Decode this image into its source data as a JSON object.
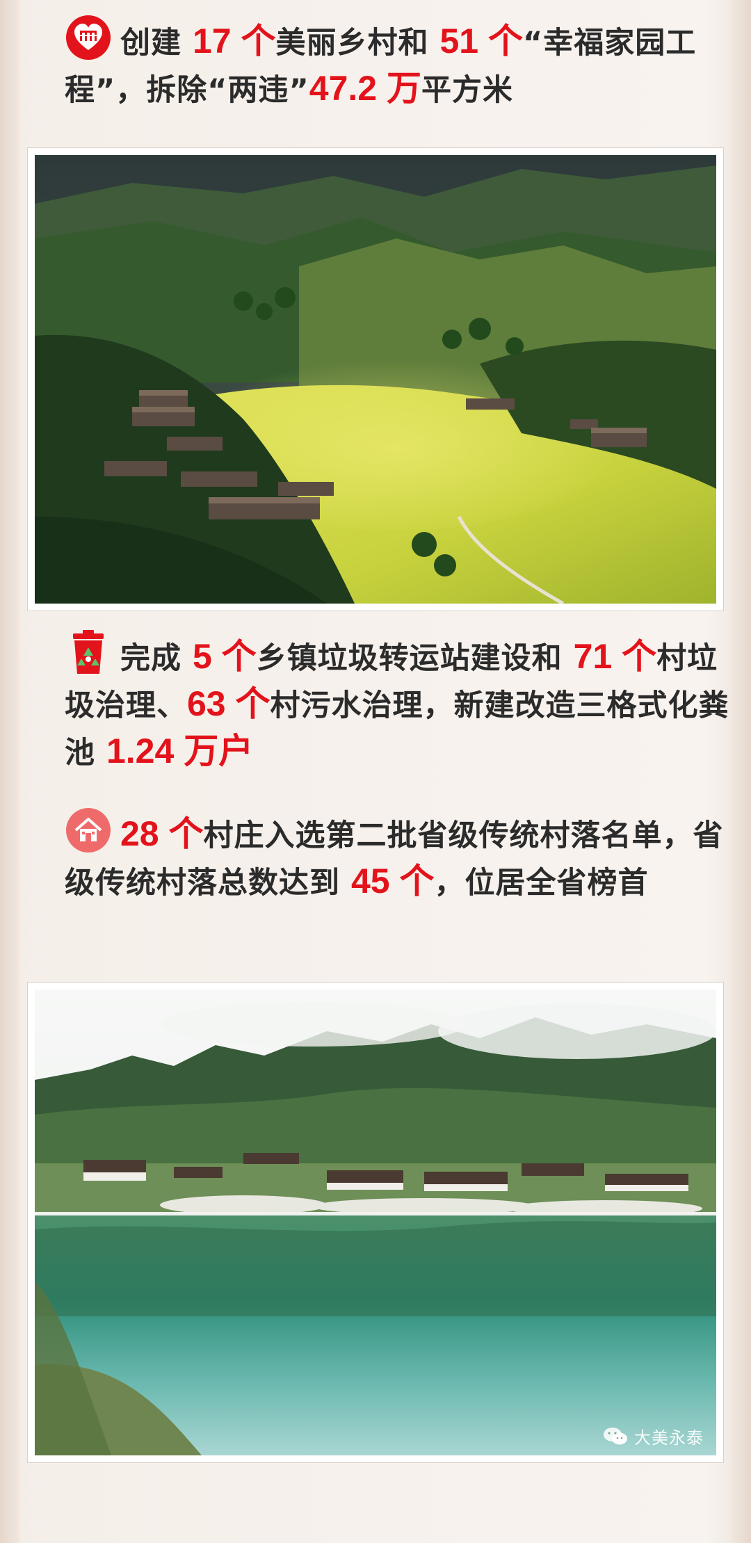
{
  "sections": [
    {
      "icon": "village-badge-icon",
      "parts": [
        {
          "t": "创建 ",
          "h": false
        },
        {
          "t": "17 个",
          "h": true
        },
        {
          "t": "美丽乡村和 ",
          "h": false
        },
        {
          "t": "51 个",
          "h": true
        },
        {
          "t": "“幸福家园工程”，拆除“两违”",
          "h": false
        },
        {
          "t": "47.2 万",
          "h": true
        },
        {
          "t": "平方米",
          "h": false
        }
      ]
    },
    {
      "icon": "trash-bin-icon",
      "parts": [
        {
          "t": "完成 ",
          "h": false
        },
        {
          "t": "5 个",
          "h": true
        },
        {
          "t": "乡镇垃圾转运站建设和 ",
          "h": false
        },
        {
          "t": "71 个",
          "h": true
        },
        {
          "t": "村垃圾治理、",
          "h": false
        },
        {
          "t": "63 个",
          "h": true
        },
        {
          "t": "村污水治理，新建改造三格式化粪池 ",
          "h": false
        },
        {
          "t": "1.24 万户",
          "h": true
        }
      ]
    },
    {
      "icon": "house-circle-icon",
      "parts": [
        {
          "t": "28 个",
          "h": true
        },
        {
          "t": "村庄入选第二批省级传统村落名单，省级传统村落总数达到 ",
          "h": false
        },
        {
          "t": "45 个",
          "h": true
        },
        {
          "t": "，位居全省榜首",
          "h": false
        }
      ]
    }
  ],
  "photos": [
    {
      "name": "terraced-valley-village-photo"
    },
    {
      "name": "lakeside-village-photo"
    }
  ],
  "watermark": {
    "text": "大美永泰",
    "icon": "wechat-icon"
  },
  "colors": {
    "highlight": "#e3131b",
    "text": "#2b2b2b",
    "background": "#f5efea"
  }
}
